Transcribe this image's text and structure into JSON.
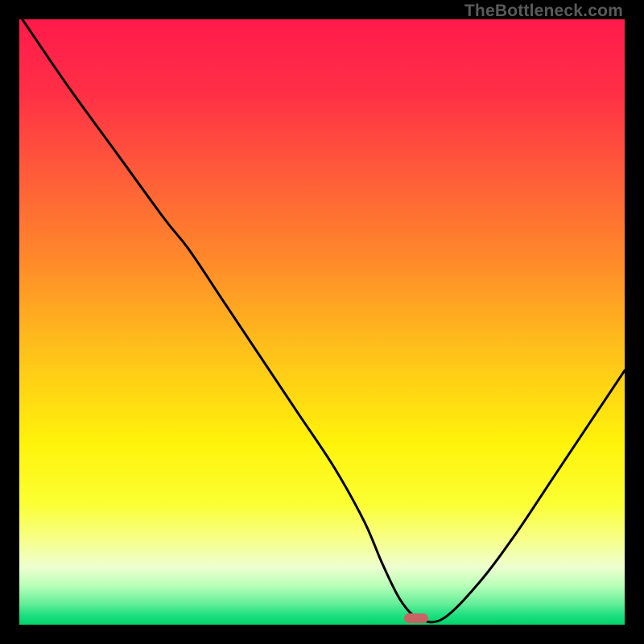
{
  "watermark": "TheBottleneck.com",
  "marker": {
    "x_pct": 65.5,
    "color": "#c86464"
  },
  "gradient_stops": [
    {
      "offset": 0.0,
      "color": "#ff1a4b"
    },
    {
      "offset": 0.12,
      "color": "#ff2f46"
    },
    {
      "offset": 0.25,
      "color": "#ff5a3a"
    },
    {
      "offset": 0.4,
      "color": "#ff8a2a"
    },
    {
      "offset": 0.55,
      "color": "#ffc21a"
    },
    {
      "offset": 0.7,
      "color": "#fff30a"
    },
    {
      "offset": 0.8,
      "color": "#fbff33"
    },
    {
      "offset": 0.86,
      "color": "#f7ff8a"
    },
    {
      "offset": 0.905,
      "color": "#eeffd0"
    },
    {
      "offset": 0.935,
      "color": "#baffba"
    },
    {
      "offset": 0.965,
      "color": "#66ee99"
    },
    {
      "offset": 0.985,
      "color": "#1adf7f"
    },
    {
      "offset": 1.0,
      "color": "#05d46a"
    }
  ],
  "chart_data": {
    "type": "line",
    "title": "",
    "xlabel": "",
    "ylabel": "",
    "xlim": [
      0,
      100
    ],
    "ylim": [
      0,
      100
    ],
    "legend": false,
    "grid": false,
    "series": [
      {
        "name": "bottleneck-curve",
        "x": [
          0.5,
          8,
          16,
          24,
          28,
          34,
          40,
          46,
          52,
          57,
          60,
          63,
          66,
          70,
          76,
          82,
          88,
          94,
          100
        ],
        "y": [
          100,
          89,
          78,
          67,
          62,
          53,
          44,
          35,
          26,
          17,
          10,
          4,
          1,
          1,
          7,
          15,
          24,
          33,
          42
        ]
      }
    ],
    "annotations": [
      {
        "type": "marker",
        "x": 65.5,
        "y": 0,
        "label": "optimal-point",
        "color": "#c86464"
      }
    ],
    "background": "vertical-gradient red→orange→yellow→green"
  }
}
